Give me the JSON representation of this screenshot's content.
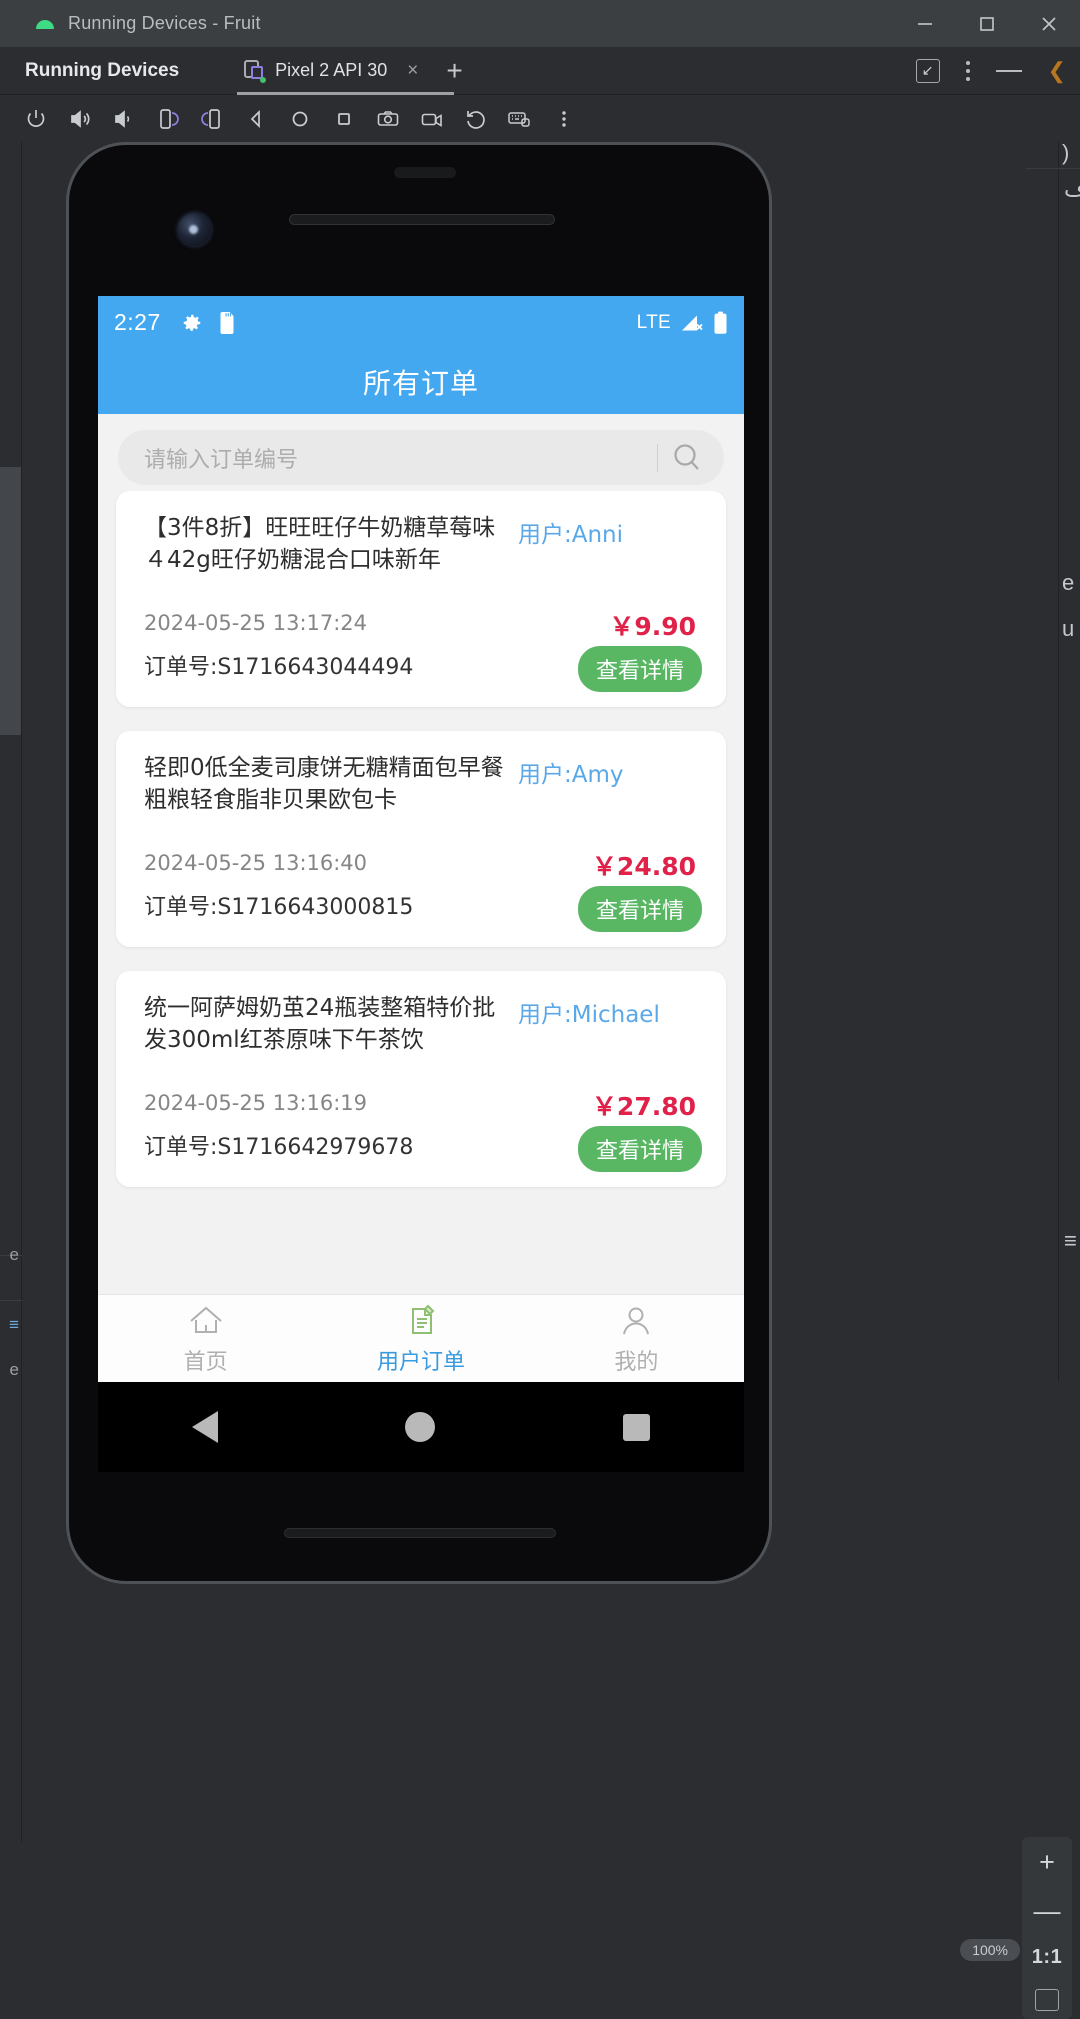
{
  "window": {
    "title": "Running Devices - Fruit",
    "logo_icon": "android-logo-icon",
    "minimize_label": "—",
    "maximize_label": "□",
    "close_label": "✕"
  },
  "tool_window": {
    "label": "Running Devices",
    "device_tab": {
      "name": "Pixel 2 API 30",
      "device_icon": "android-device-icon",
      "close_label": "×"
    },
    "add_tab_label": "+",
    "settings_icon": "settings-gear-icon",
    "more_icon": "more-vertical-icon",
    "hide_icon": "hide-tool-window-icon"
  },
  "emulator_toolbar": {
    "buttons": [
      {
        "icon": "power-icon",
        "label": "Power"
      },
      {
        "icon": "volume-up-icon",
        "label": "Volume Up"
      },
      {
        "icon": "volume-down-icon",
        "label": "Volume Down"
      },
      {
        "icon": "rotate-left-icon",
        "label": "Rotate Left"
      },
      {
        "icon": "rotate-right-icon",
        "label": "Rotate Right"
      },
      {
        "icon": "back-icon",
        "label": "Back"
      },
      {
        "icon": "home-icon",
        "label": "Home"
      },
      {
        "icon": "overview-icon",
        "label": "Overview"
      },
      {
        "icon": "screenshot-camera-icon",
        "label": "Take Screenshot"
      },
      {
        "icon": "screen-record-icon",
        "label": "Record Screen"
      },
      {
        "icon": "rotate-undo-icon",
        "label": "Rotate"
      },
      {
        "icon": "keyboard-shortcuts-icon",
        "label": "Keyboard Shortcuts"
      },
      {
        "icon": "more-vertical-icon",
        "label": "More"
      }
    ]
  },
  "zoom_controls": {
    "zoom_in_label": "+",
    "zoom_out_label": "—",
    "actual_size_label": "1:1",
    "fit_icon": "zoom-fit-icon",
    "tooltip": "100%"
  },
  "device": {
    "model_icon": "pixel-2-frame",
    "camera_icon": "front-camera-icon",
    "speaker_icon": "earpiece-speaker-icon"
  },
  "android": {
    "statusbar": {
      "time": "2:27",
      "icons_left": [
        "settings-gear-icon",
        "sd-card-icon"
      ],
      "network_label": "LTE",
      "signal_icon": "signal-off-icon",
      "battery_icon": "battery-full-icon"
    },
    "navbar": {
      "back_icon": "nav-back-triangle-icon",
      "home_icon": "nav-home-circle-icon",
      "recents_icon": "nav-recents-square-icon"
    }
  },
  "app": {
    "header": {
      "title": "所有订单"
    },
    "accent_color": "#44a8f0",
    "search": {
      "placeholder": "请输入订单编号",
      "value": "",
      "search_icon": "search-icon"
    },
    "orders": [
      {
        "title": "【3件8折】旺旺旺仔牛奶糖草莓味４42g旺仔奶糖混合口味新年",
        "user_label": "用户:Anni",
        "datetime": "2024-05-25 13:17:24",
        "order_no": "订单号:S1716643044494",
        "price": "￥9.90",
        "detail_button": "查看详情"
      },
      {
        "title": "轻即0低全麦司康饼无糖精面包早餐粗粮轻食脂非贝果欧包卡",
        "user_label": "用户:Amy",
        "datetime": "2024-05-25 13:16:40",
        "order_no": "订单号:S1716643000815",
        "price": "￥24.80",
        "detail_button": "查看详情"
      },
      {
        "title": "统一阿萨姆奶茧24瓶装整箱特价批发300ml红茶原味下午茶饮",
        "user_label": "用户:Michael",
        "datetime": "2024-05-25 13:16:19",
        "order_no": "订单号:S1716642979678",
        "price": "￥27.80",
        "detail_button": "查看详情"
      }
    ],
    "bottom_nav": [
      {
        "label": "首页",
        "icon": "home-outline-icon",
        "active": false
      },
      {
        "label": "用户订单",
        "icon": "order-document-icon",
        "active": true
      },
      {
        "label": "我的",
        "icon": "person-outline-icon",
        "active": false
      }
    ]
  },
  "background_editor": {
    "right_fragments": [
      ")",
      "ف",
      "e",
      "u",
      "≡"
    ],
    "left_fragments": [
      "e",
      "≡",
      "e"
    ]
  }
}
